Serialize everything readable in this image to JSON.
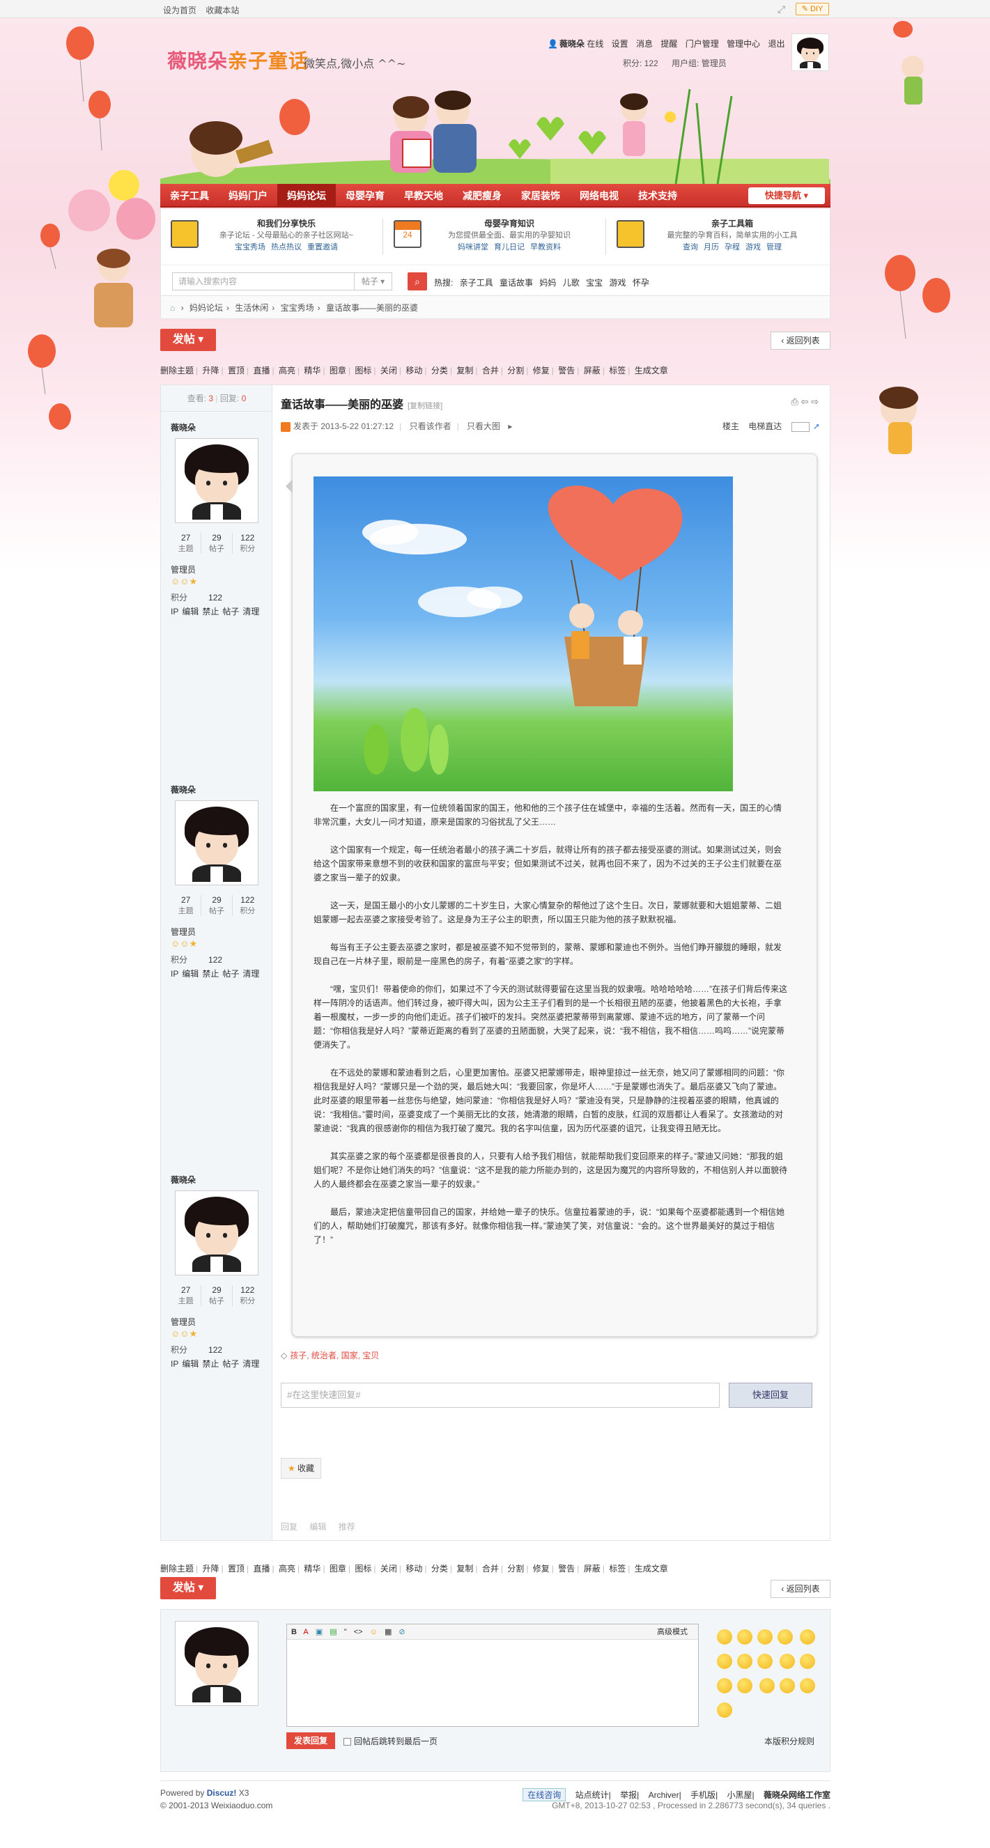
{
  "topbar": {
    "sethome": "设为首页",
    "fav": "收藏本站",
    "diy": "DIY"
  },
  "site": {
    "logo_main": "薇晓朵",
    "logo_sub": "亲子童话",
    "slogan": "微笑点,微小点 ^^~"
  },
  "user": {
    "name": "薇晓朵",
    "status": "在线",
    "settings": "设置",
    "messages": "消息",
    "remind": "提醒",
    "portal_admin": "门户管理",
    "admin_center": "管理中心",
    "logout": "退出",
    "points": "积分: 122",
    "group": "用户组: 管理员"
  },
  "nav": {
    "items": [
      "亲子工具",
      "妈妈门户",
      "妈妈论坛",
      "母婴孕育",
      "早教天地",
      "减肥瘦身",
      "家居装饰",
      "网络电视",
      "技术支持"
    ],
    "active_index": 2,
    "quick": "快捷导航"
  },
  "info": [
    {
      "title": "和我们分享快乐",
      "desc": "亲子论坛 - 父母最贴心的亲子社区网站~",
      "links": [
        "宝宝秀场",
        "热点热议",
        "重置邀请"
      ]
    },
    {
      "title": "母婴孕育知识",
      "desc": "为您提供最全面、最实用的孕婴知识",
      "links": [
        "妈咪讲堂",
        "育儿日记",
        "早教资料"
      ]
    },
    {
      "title": "亲子工具箱",
      "desc": "最完整的孕育百科，简单实用的小工具",
      "links": [
        "查询",
        "月历",
        "孕程",
        "游戏",
        "管理"
      ]
    }
  ],
  "search": {
    "placeholder": "请输入搜索内容",
    "type": "帖子",
    "hot_label": "热搜:",
    "hot": [
      "亲子工具",
      "童话故事",
      "妈妈",
      "儿歌",
      "宝宝",
      "游戏",
      "怀孕"
    ]
  },
  "breadcrumb": [
    "妈妈论坛",
    "生活休闲",
    "宝宝秀场",
    "童话故事——美丽的巫婆"
  ],
  "actions": {
    "post": "发帖",
    "back": "返回列表"
  },
  "modbar": [
    "删除主题",
    "升降",
    "置顶",
    "直播",
    "高亮",
    "精华",
    "图章",
    "图标",
    "关闭",
    "移动",
    "分类",
    "复制",
    "合并",
    "分割",
    "修复",
    "警告",
    "屏蔽",
    "标签",
    "生成文章"
  ],
  "thread": {
    "views_label": "查看:",
    "views": "3",
    "replies_label": "回复:",
    "replies": "0",
    "title": "童话故事——美丽的巫婆",
    "copy": "[复制链接]",
    "posted": "发表于 2013-5-22 01:27:12",
    "only_author": "只看该作者",
    "big_img": "只看大图",
    "floor": "楼主",
    "jump": "电梯直达"
  },
  "author": {
    "name": "薇晓朵",
    "topics": "27",
    "topics_label": "主题",
    "posts": "29",
    "posts_label": "帖子",
    "credits": "122",
    "credits_label": "积分",
    "group": "管理员",
    "jf_label": "积分",
    "jf": "122",
    "ops": [
      "IP",
      "编辑",
      "禁止",
      "帖子",
      "清理"
    ]
  },
  "story": [
    "在一个富庶的国家里，有一位统领着国家的国王，他和他的三个孩子住在城堡中，幸福的生活着。然而有一天，国王的心情非常沉重，大女儿一问才知道，原来是国家的习俗扰乱了父王……",
    "这个国家有一个规定，每一任统治者最小的孩子满二十岁后，就得让所有的孩子都去接受巫婆的测试。如果测试过关，则会给这个国家带来意想不到的收获和国家的富庶与平安；但如果测试不过关，就再也回不来了，因为不过关的王子公主们就要在巫婆之家当一辈子的奴隶。",
    "这一天，是国王最小的小女儿蒙娜的二十岁生日，大家心情复杂的帮他过了这个生日。次日，蒙娜就要和大姐姐蒙蒂、二姐姐蒙娜一起去巫婆之家接受考验了。这是身为王子公主的职责，所以国王只能为他的孩子默默祝福。",
    "每当有王子公主要去巫婆之家时，都是被巫婆不知不觉带到的，蒙蒂、蒙娜和蒙迪也不例外。当他们睁开朦胧的睡眼，就发现自己在一片林子里，眼前是一座黑色的房子，有着“巫婆之家”的字样。",
    "“嘿，宝贝们！带着使命的你们，如果过不了今天的测试就得要留在这里当我的奴隶哦。哈哈哈哈哈……”在孩子们背后传来这样一阵阴冷的话语声。他们转过身，被吓得大叫，因为公主王子们看到的是一个长相很丑陋的巫婆，他披着黑色的大长袍，手拿着一根魔杖，一步一步的向他们走近。孩子们被吓的发抖。突然巫婆把蒙蒂带到离蒙娜、蒙迪不远的地方，问了蒙蒂一个问题：“你相信我是好人吗？”蒙蒂近距离的看到了巫婆的丑陋面貌，大哭了起来，说：“我不相信，我不相信……呜呜……”说完蒙蒂便消失了。",
    "在不远处的蒙娜和蒙迪看到之后，心里更加害怕。巫婆又把蒙娜带走，眼神里掠过一丝无奈，她又问了蒙娜相同的问题：“你相信我是好人吗？”蒙娜只是一个劲的哭，最后她大叫：“我要回家，你是坏人……”于是蒙娜也消失了。最后巫婆又飞向了蒙迪。此时巫婆的眼里带着一丝悲伤与绝望，她问蒙迪：“你相信我是好人吗？”蒙迪没有哭，只是静静的注视着巫婆的眼睛，他真诚的说：“我相信。”霎时间，巫婆变成了一个美丽无比的女孩，她清澈的眼睛，白皙的皮肤，红润的双唇都让人看呆了。女孩激动的对蒙迪说：“我真的很感谢你的相信为我打破了魔咒。我的名字叫信童，因为历代巫婆的诅咒，让我变得丑陋无比。",
    "其实巫婆之家的每个巫婆都是很善良的人，只要有人给予我们相信，就能帮助我们变回原来的样子。”蒙迪又问她：“那我的姐姐们呢？不是你让她们消失的吗？”信童说：“这不是我的能力所能办到的，这是因为魔咒的内容所导致的，不相信别人并以面貌待人的人最终都会在巫婆之家当一辈子的奴隶。”",
    "最后，蒙迪决定把信童带回自己的国家，并给她一辈子的快乐。信童拉着蒙迪的手，说：“如果每个巫婆都能遇到一个相信她们的人，帮助她们打破魔咒，那该有多好。就像你相信我一样。”蒙迪笑了笑，对信童说：“会的。这个世界最美好的莫过于相信了！”"
  ],
  "tags": {
    "label": "孩子, 统治者, 国家, 宝贝"
  },
  "quickreply": {
    "placeholder": "#在这里快速回复#",
    "button": "快速回复"
  },
  "favorite": "收藏",
  "postactions": [
    "回复",
    "编辑",
    "推荐"
  ],
  "reply": {
    "advanced": "高级模式",
    "submit": "发表回复",
    "check": "回帖后跳转到最后一页",
    "rules": "本版积分规则",
    "toolbar": [
      "B",
      "A",
      "▣",
      "▤",
      "\"",
      "<>",
      "☺",
      "▦",
      "⊘"
    ]
  },
  "footer": {
    "powered_prefix": "Powered by ",
    "powered_name": "Discuz!",
    "powered_ver": " X3",
    "copy": "© 2001-2013 Weixiaoduo.com",
    "online": "在线咨询",
    "links": [
      "站点统计",
      "举报",
      "Archiver",
      "手机版",
      "小黑屋"
    ],
    "studio": "薇晓朵网络工作室",
    "meta": "GMT+8, 2013-10-27 02:53 , Processed in 2.286773 second(s), 34 queries ."
  }
}
